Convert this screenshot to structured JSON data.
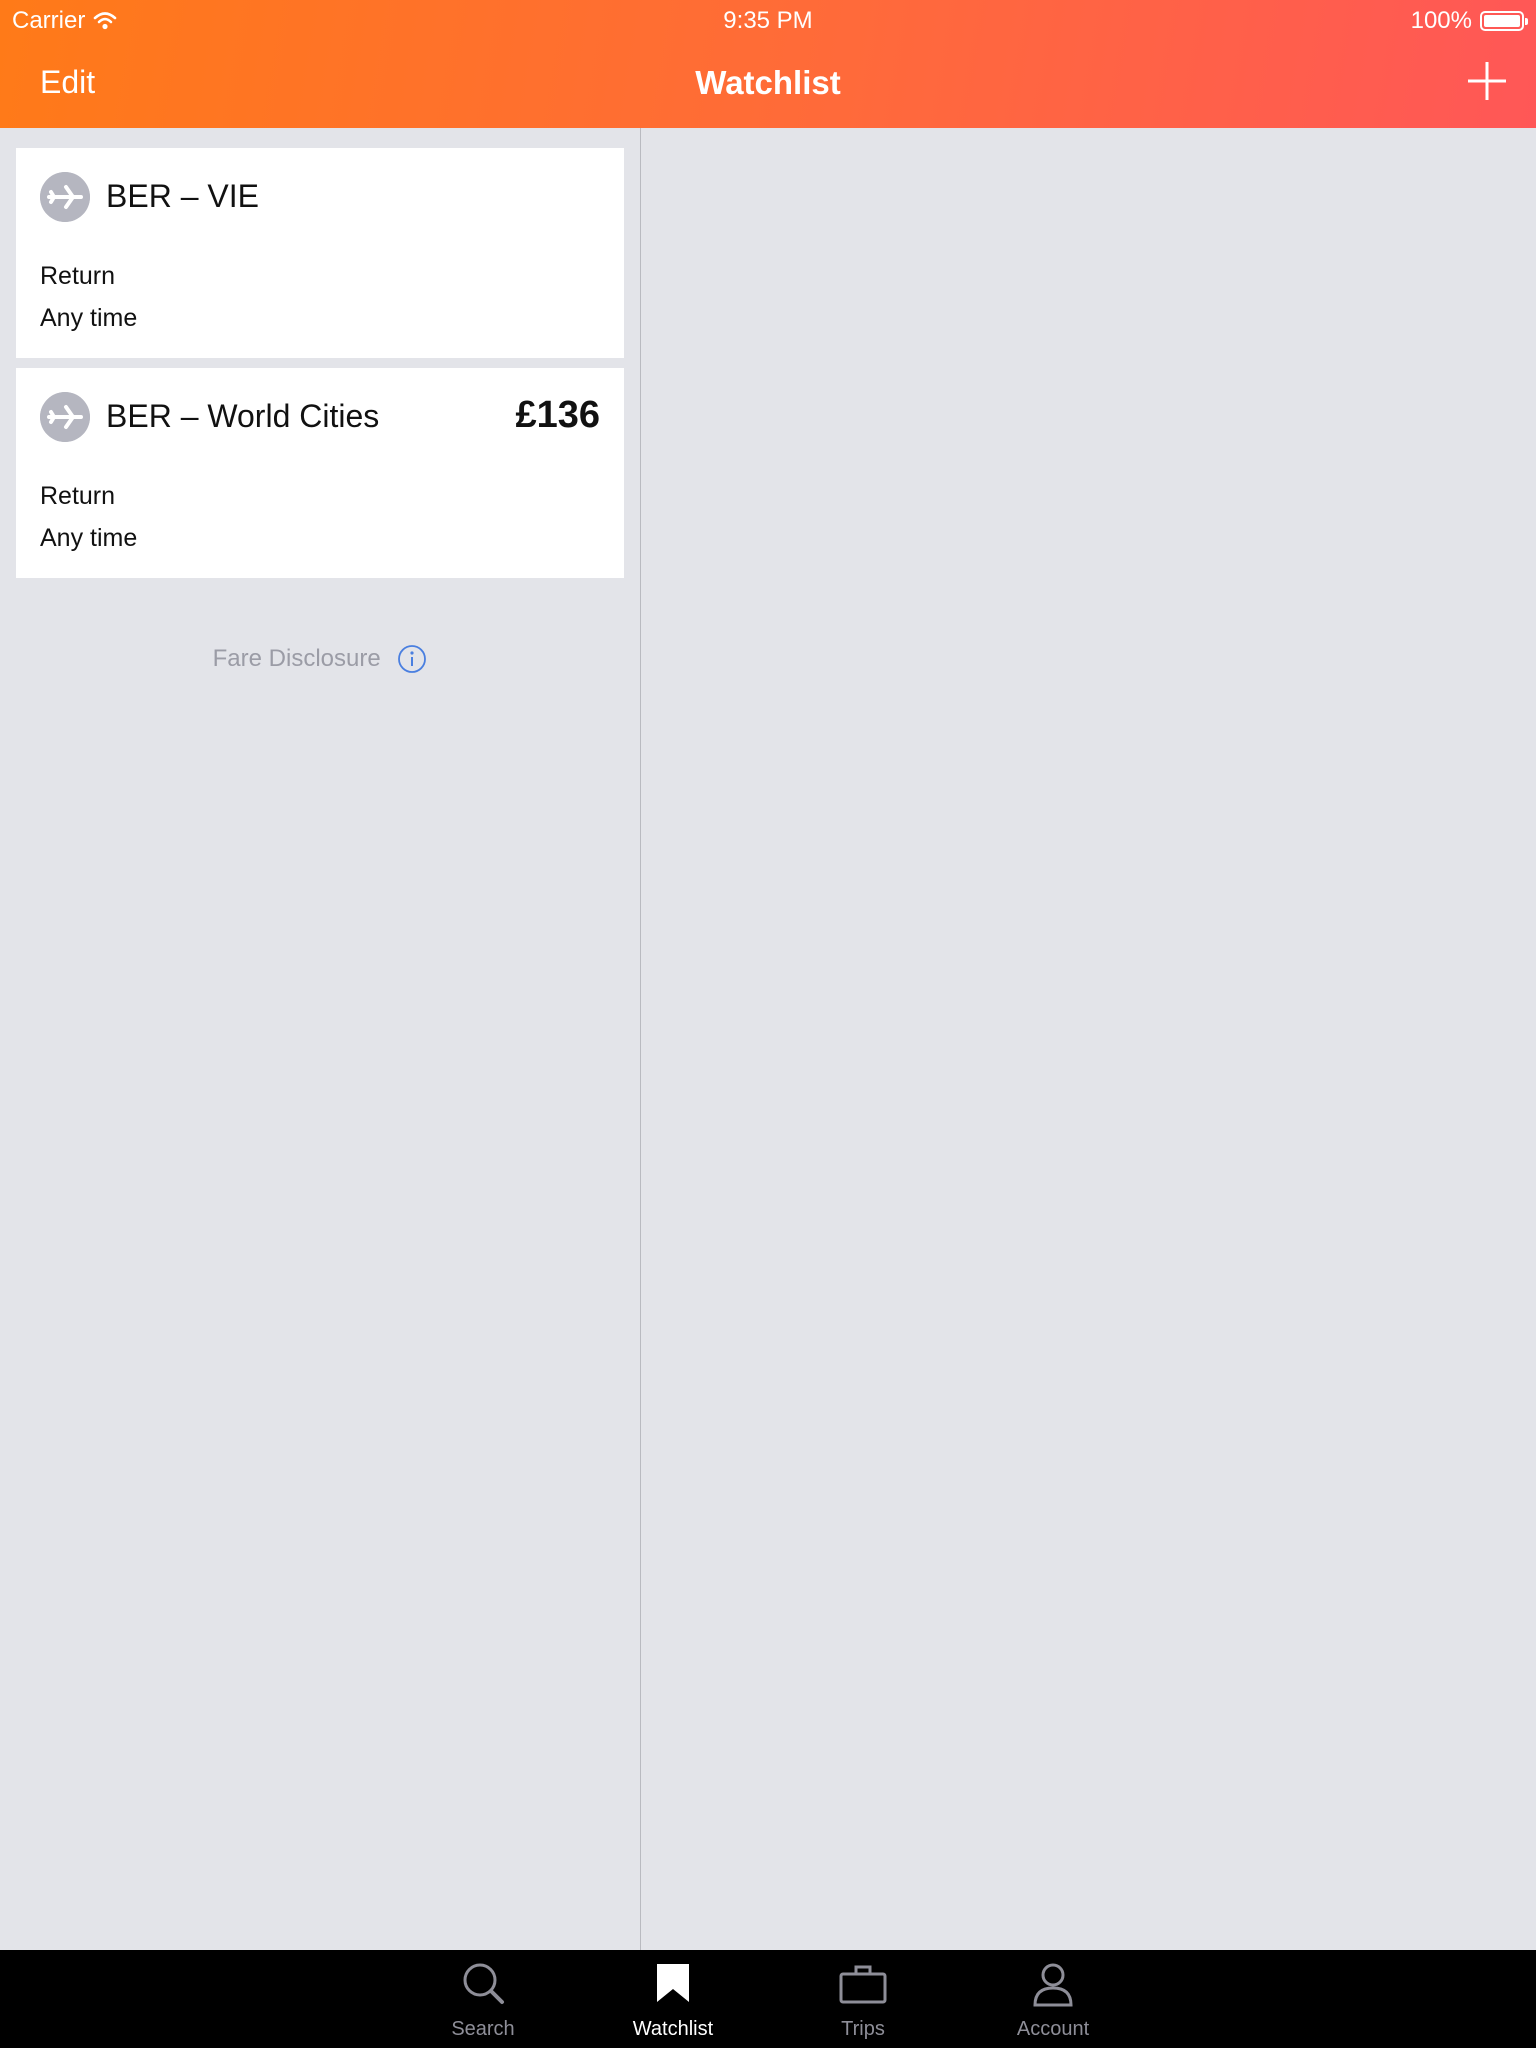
{
  "status_bar": {
    "carrier": "Carrier",
    "time": "9:35 PM",
    "battery": "100%"
  },
  "nav": {
    "edit_label": "Edit",
    "title": "Watchlist",
    "add_icon": "plus-icon"
  },
  "watchlist": [
    {
      "route": "BER – VIE",
      "price": "",
      "trip_type": "Return",
      "dates": "Any time",
      "icon": "airplane-icon"
    },
    {
      "route": "BER – World Cities",
      "price": "£136",
      "trip_type": "Return",
      "dates": "Any time",
      "icon": "airplane-icon"
    }
  ],
  "fare_disclosure": {
    "label": "Fare Disclosure",
    "icon": "info-icon"
  },
  "tabs": [
    {
      "label": "Search",
      "icon": "search-icon",
      "active": false
    },
    {
      "label": "Watchlist",
      "icon": "bookmark-icon",
      "active": true
    },
    {
      "label": "Trips",
      "icon": "briefcase-icon",
      "active": false
    },
    {
      "label": "Account",
      "icon": "person-icon",
      "active": false
    }
  ],
  "colors": {
    "header_start": "#ff7a18",
    "header_end": "#ff5757",
    "background": "#e3e4e9",
    "info": "#4a7fe0"
  }
}
